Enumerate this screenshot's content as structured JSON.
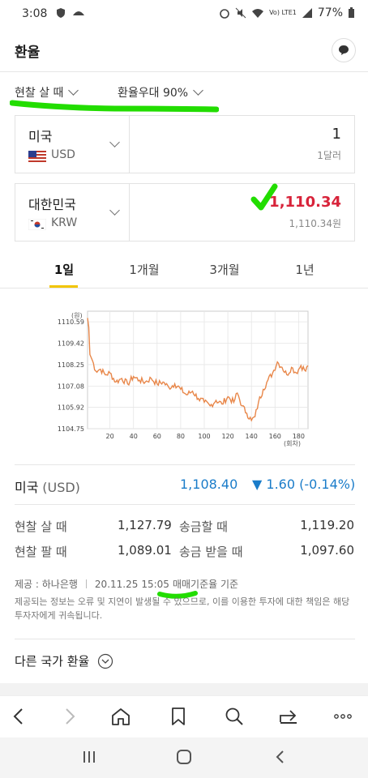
{
  "status_bar": {
    "time": "3:08",
    "battery": "77%",
    "signal_text": "Vo) LTE1"
  },
  "header": {
    "title": "환율"
  },
  "filters": {
    "mode": "현찰 살 때",
    "discount": "환율우대 90%"
  },
  "from_currency": {
    "country": "미국",
    "code": "USD",
    "amount": "1",
    "amount_label": "1달러"
  },
  "to_currency": {
    "country": "대한민국",
    "code": "KRW",
    "amount": "1,110.34",
    "amount_label": "1,110.34원",
    "amount_color": "#d8233a"
  },
  "tabs": [
    {
      "label": "1일"
    },
    {
      "label": "1개월"
    },
    {
      "label": "3개월"
    },
    {
      "label": "1년"
    }
  ],
  "chart_data": {
    "type": "line",
    "ylabel": "(원)",
    "xlabel": "(회차)",
    "y_ticks": [
      "1110.59",
      "1109.42",
      "1108.25",
      "1107.08",
      "1105.92",
      "1104.75"
    ],
    "x_ticks": [
      "20",
      "40",
      "60",
      "80",
      "100",
      "120",
      "140",
      "160",
      "180"
    ],
    "ylim": [
      1104.75,
      1111.17
    ],
    "xlim": [
      1,
      188
    ],
    "line_color": "#e8874a",
    "points": [
      [
        1,
        1110.8
      ],
      [
        2,
        1110.3
      ],
      [
        3,
        1108.8
      ],
      [
        5,
        1108.5
      ],
      [
        8,
        1107.9
      ],
      [
        12,
        1108.0
      ],
      [
        16,
        1107.7
      ],
      [
        20,
        1107.8
      ],
      [
        25,
        1107.3
      ],
      [
        30,
        1107.5
      ],
      [
        35,
        1107.2
      ],
      [
        40,
        1107.6
      ],
      [
        45,
        1107.4
      ],
      [
        50,
        1107.3
      ],
      [
        55,
        1107.5
      ],
      [
        60,
        1107.2
      ],
      [
        65,
        1107.3
      ],
      [
        70,
        1107.0
      ],
      [
        75,
        1107.2
      ],
      [
        80,
        1106.9
      ],
      [
        85,
        1106.6
      ],
      [
        90,
        1106.8
      ],
      [
        95,
        1106.4
      ],
      [
        100,
        1106.2
      ],
      [
        105,
        1106.0
      ],
      [
        110,
        1106.3
      ],
      [
        115,
        1106.1
      ],
      [
        120,
        1106.5
      ],
      [
        125,
        1106.2
      ],
      [
        128,
        1106.7
      ],
      [
        132,
        1106.0
      ],
      [
        136,
        1105.6
      ],
      [
        140,
        1105.2
      ],
      [
        143,
        1105.4
      ],
      [
        146,
        1106.2
      ],
      [
        150,
        1106.9
      ],
      [
        154,
        1107.4
      ],
      [
        158,
        1107.8
      ],
      [
        162,
        1108.4
      ],
      [
        166,
        1108.1
      ],
      [
        170,
        1107.7
      ],
      [
        174,
        1108.1
      ],
      [
        178,
        1107.8
      ],
      [
        182,
        1108.2
      ],
      [
        186,
        1107.9
      ],
      [
        188,
        1108.2
      ]
    ]
  },
  "summary": {
    "country": "미국",
    "code": "(USD)",
    "rate": "1,108.40",
    "change": "▼ 1.60 (-0.14%)",
    "rate_color": "#1a7cc9",
    "change_color": "#1a7cc9"
  },
  "rates": {
    "cash_buy_label": "현찰 살 때",
    "cash_buy": "1,127.79",
    "cash_sell_label": "현찰 팔 때",
    "cash_sell": "1,089.01",
    "send_label": "송금할 때",
    "send": "1,119.20",
    "receive_label": "송금 받을 때",
    "receive": "1,097.60"
  },
  "source": {
    "provider": "제공 : 하나은행",
    "date": "20.11.25",
    "time": "15:05",
    "basis": "매매기준율 기준",
    "disclaimer": "제공되는 정보는 오류 및 지연이 발생될 수 있으므로, 이를 이용한 투자에 대한 책임은 해당 투자자에게 귀속됩니다."
  },
  "other_rates": {
    "label": "다른 국가 환율"
  },
  "nav": {
    "icons": [
      "back-icon",
      "forward-icon",
      "home-icon",
      "bookmark-icon",
      "search-icon",
      "share-icon",
      "more-icon"
    ]
  },
  "colors": {
    "accent": "#f2c500",
    "highlight": "#22dd00"
  }
}
